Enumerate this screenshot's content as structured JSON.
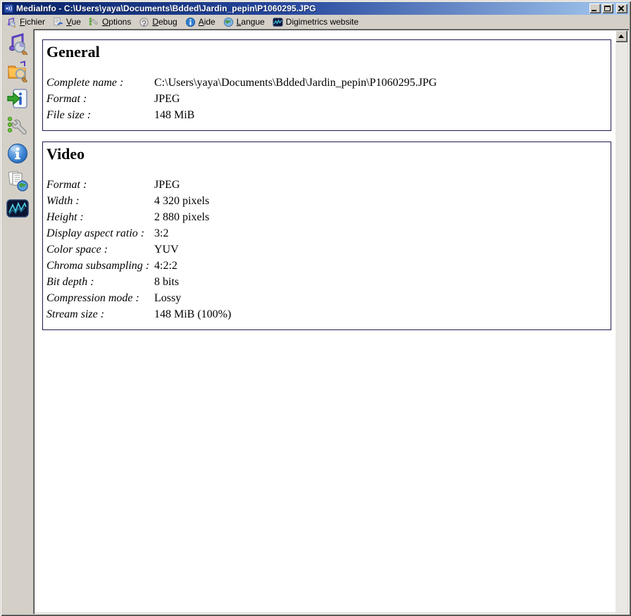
{
  "window": {
    "title": "MediaInfo - C:\\Users\\yaya\\Documents\\Bdded\\Jardin_pepin\\P1060295.JPG",
    "app_icon": "mediainfo-icon",
    "controls": [
      {
        "name": "minimize-button",
        "icon": "minimize-icon"
      },
      {
        "name": "maximize-button",
        "icon": "maximize-icon"
      },
      {
        "name": "close-button",
        "icon": "close-icon"
      }
    ]
  },
  "menu": {
    "items": [
      {
        "label": "Fichier",
        "accel": "F",
        "icon": "open-file-menu-icon"
      },
      {
        "label": "Vue",
        "accel": "V",
        "icon": "view-menu-icon"
      },
      {
        "label": "Options",
        "accel": "O",
        "icon": "options-menu-icon"
      },
      {
        "label": "Debug",
        "accel": "D",
        "icon": "debug-menu-icon"
      },
      {
        "label": "Aide",
        "accel": "A",
        "icon": "help-menu-icon"
      },
      {
        "label": "Langue",
        "accel": "L",
        "icon": "language-menu-icon"
      },
      {
        "label": "Digimetrics website",
        "accel": "",
        "icon": "digimetrics-menu-icon"
      }
    ]
  },
  "toolbar": {
    "buttons": [
      {
        "name": "open-file-button",
        "icon": "open-file-icon"
      },
      {
        "name": "open-folder-button",
        "icon": "open-folder-icon"
      },
      {
        "name": "export-info-button",
        "icon": "export-info-icon"
      },
      {
        "name": "options-button",
        "icon": "wrench-icon"
      },
      {
        "name": "about-button",
        "icon": "info-circle-icon"
      },
      {
        "name": "report-web-button",
        "icon": "documents-globe-icon"
      },
      {
        "name": "digimetrics-button",
        "icon": "waveform-icon"
      }
    ]
  },
  "sections": [
    {
      "title": "General",
      "rows": [
        {
          "label": "Complete name :",
          "value": "C:\\Users\\yaya\\Documents\\Bdded\\Jardin_pepin\\P1060295.JPG"
        },
        {
          "label": "Format :",
          "value": "JPEG"
        },
        {
          "label": "File size :",
          "value": "148 MiB"
        }
      ]
    },
    {
      "title": "Video",
      "rows": [
        {
          "label": "Format :",
          "value": "JPEG"
        },
        {
          "label": "Width :",
          "value": "4 320 pixels"
        },
        {
          "label": "Height :",
          "value": "2 880 pixels"
        },
        {
          "label": "Display aspect ratio :",
          "value": "3:2"
        },
        {
          "label": "Color space :",
          "value": "YUV"
        },
        {
          "label": "Chroma subsampling :",
          "value": "4:2:2"
        },
        {
          "label": "Bit depth :",
          "value": "8 bits"
        },
        {
          "label": "Compression mode :",
          "value": "Lossy"
        },
        {
          "label": "Stream size :",
          "value": "148 MiB (100%)"
        }
      ]
    }
  ],
  "colors": {
    "titlebar_gradient_left": "#0a246a",
    "titlebar_gradient_right": "#a6caf0",
    "chrome": "#d4d0c8",
    "section_border": "#1c1c52",
    "content_background": "#ffffff",
    "text": "#000000"
  }
}
